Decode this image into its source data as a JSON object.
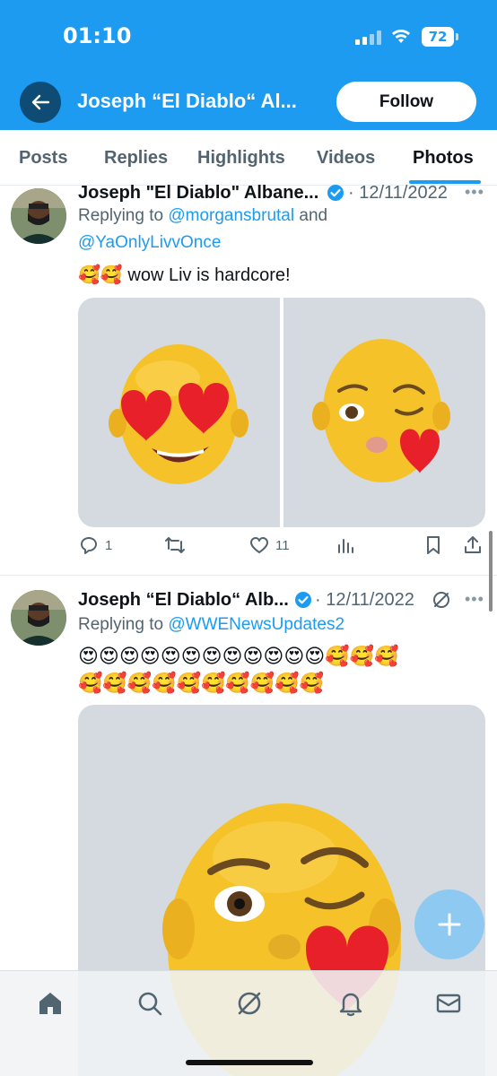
{
  "status_bar": {
    "time": "01:10",
    "battery": "72"
  },
  "header": {
    "title": "Joseph “El Diablo“ Al...",
    "follow_label": "Follow"
  },
  "tabs": [
    {
      "label": "Posts"
    },
    {
      "label": "Replies"
    },
    {
      "label": "Highlights"
    },
    {
      "label": "Videos"
    },
    {
      "label": "Photos",
      "active": true
    }
  ],
  "tweets": [
    {
      "name": "Joseph \"El Diablo\" Albane...",
      "date": "· 12/11/2022",
      "replying_prefix": "Replying to",
      "mention_1": "@morgansbrutal",
      "mention_joiner": " and",
      "mention_2": "@YaOnlyLivvOnce",
      "text": "wow Liv is hardcore!",
      "text_emoji": "🥰🥰",
      "replies": "1",
      "likes": "11"
    },
    {
      "name": "Joseph “El Diablo“ Alb...",
      "date": "· 12/11/2022",
      "replying_prefix": "Replying to",
      "mention_1": "@WWENewsUpdates2",
      "emoji_line_1": "😍😍😍😍😍😍😍😍😍😍😍😍🥰🥰🥰",
      "emoji_line_2": "🥰🥰🥰🥰🥰🥰🥰🥰🥰🥰"
    }
  ],
  "icons": {
    "back": "arrow-left-icon",
    "verified": "verified-badge-icon",
    "more": "more-dots-icon",
    "reply": "reply-icon",
    "retweet": "retweet-icon",
    "like": "heart-icon",
    "views": "views-icon",
    "bookmark": "bookmark-icon",
    "share": "share-icon",
    "grok": "grok-icon",
    "compose": "compose-plus-icon",
    "home": "home-icon",
    "search": "search-icon",
    "notifications": "bell-icon",
    "messages": "mail-icon"
  },
  "colors": {
    "brand": "#1d9bf0",
    "secondary_text": "#536471",
    "verified": "#1d9bf0"
  }
}
